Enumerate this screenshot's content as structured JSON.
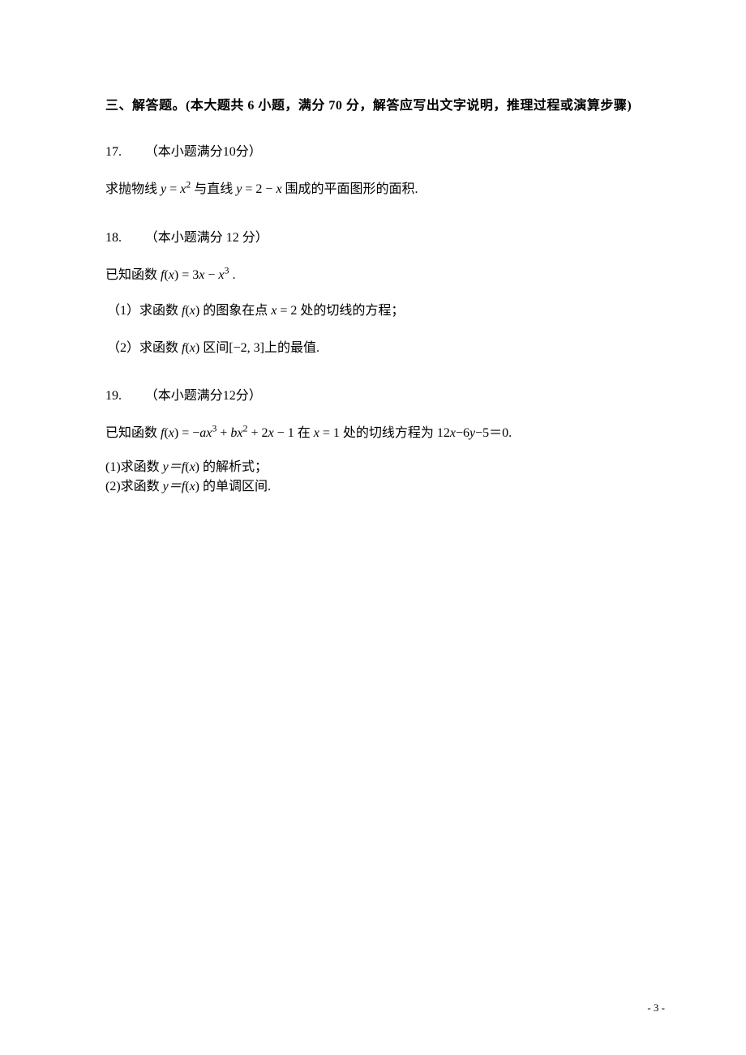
{
  "sectionTitle": "三、解答题。(本大题共 6 小题，满分 70 分，解答应写出文字说明，推理过程或演算步骤)",
  "q17": {
    "number": "17.",
    "points": "（本小题满分10分）",
    "line1_a": "求抛物线 ",
    "eq1_lhs": "y",
    "eq1_eq": " = ",
    "eq1_rhs": "x",
    "eq1_exp": "2",
    "line1_b": " 与直线 ",
    "eq2_lhs": "y",
    "eq2_eq": " = 2 − ",
    "eq2_rhs": "x",
    "line1_c": " 围成的平面图形的面积."
  },
  "q18": {
    "number": "18.",
    "points": "（本小题满分 12 分）",
    "line1_a": "已知函数 ",
    "fn": "f",
    "fnarg_l": "(",
    "fnarg": "x",
    "fnarg_r": ")",
    "eq": " = 3",
    "var1": "x",
    "minus": " − ",
    "var2": "x",
    "exp": "3",
    "line1_end": " .",
    "part1_a": "（1）求函数 ",
    "part1_b": " 的图象在点 ",
    "part1_c": "x",
    "part1_eq": " = 2",
    "part1_d": " 处的切线的方程；",
    "part2_a": "（2）求函数 ",
    "part2_b": " 区间",
    "interval": "[−2, 3]",
    "part2_c": "上的最值."
  },
  "q19": {
    "number": "19.",
    "points": "（本小题满分12分）",
    "line1_a": "已知函数 ",
    "fn": "f",
    "fnarg_l": "(",
    "fnarg": "x",
    "fnarg_r": ")",
    "eq": " = −",
    "a": "a",
    "x1": "x",
    "e3": "3",
    "plus1": " + ",
    "b": "b",
    "x2": "x",
    "e2": "2",
    "plus2": " + 2",
    "x3": "x",
    "minus1": " − 1",
    "in": "在 ",
    "xeq": "x",
    "xeqv": " = 1",
    "at": " 处的切线方程为 ",
    "tangent_a": "12",
    "tx": "x",
    "tangent_b": "−6",
    "ty": "y",
    "tangent_c": "−5＝0.",
    "part1_a": "(1)求函数 ",
    "yeq": "y＝",
    "part1_b": " 的解析式；",
    "part2_a": "(2)求函数 ",
    "part2_b": " 的单调区间."
  },
  "pageNumber": "- 3 -"
}
